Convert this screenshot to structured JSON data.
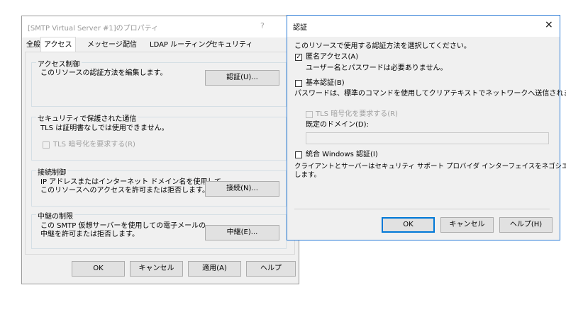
{
  "props": {
    "title": "[SMTP Virtual Server #1]のプロパティ",
    "help_glyph": "?",
    "tabs": [
      {
        "label": "全般"
      },
      {
        "label": "アクセス"
      },
      {
        "label": "メッセージ"
      },
      {
        "label": "配信"
      },
      {
        "label": "LDAP ルーティング"
      },
      {
        "label": "セキュリティ"
      }
    ],
    "access_control": {
      "legend": "アクセス制御",
      "desc": "このリソースの認証方法を編集します。",
      "button": "認証(U)..."
    },
    "secure_comm": {
      "legend": "セキュリティで保護された通信",
      "desc": "TLS は証明書なしでは使用できません。",
      "checkbox": "TLS 暗号化を要求する(R)"
    },
    "connection": {
      "legend": "接続制御",
      "desc1": "IP アドレスまたはインターネット ドメイン名を使用して、",
      "desc2": "このリソースへのアクセスを許可または拒否します。",
      "button": "接続(N)..."
    },
    "relay": {
      "legend": "中継の制限",
      "desc1": "この SMTP 仮想サーバーを使用しての電子メールの",
      "desc2": "中継を許可または拒否します。",
      "button": "中継(E)..."
    },
    "footer": {
      "ok": "OK",
      "cancel": "キャンセル",
      "apply": "適用(A)",
      "help": "ヘルプ"
    }
  },
  "auth": {
    "title": "認証",
    "close_glyph": "×",
    "intro": "このリソースで使用する認証方法を選択してください。",
    "anonymous": {
      "label": "匿名アクセス(A)",
      "checked": true,
      "check_glyph": "✓",
      "desc": "ユーザー名とパスワードは必要ありません。"
    },
    "basic": {
      "label": "基本認証(B)",
      "checked": false,
      "desc": "パスワードは、標準のコマンドを使用してクリアテキストでネットワークへ送信されます。",
      "tls_label": "TLS 暗号化を要求する(R)",
      "domain_label": "既定のドメイン(D):",
      "domain_value": ""
    },
    "windows": {
      "label": "統合 Windows 認証(I)",
      "checked": false,
      "desc1": "クライアントとサーバーはセキュリティ サポート プロバイダ インターフェイスをネゴシエート",
      "desc2": "します。"
    },
    "buttons": {
      "ok": "OK",
      "cancel": "キャンセル",
      "help": "ヘルプ(H)"
    }
  }
}
